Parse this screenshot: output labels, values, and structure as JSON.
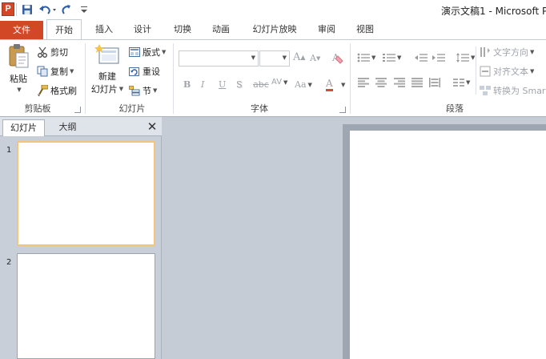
{
  "titlebar": {
    "app_icon": "P",
    "title": "演示文稿1 - Microsoft P",
    "qat_icons": [
      "save-icon",
      "undo-icon",
      "redo-icon",
      "customize-icon"
    ]
  },
  "tabs": {
    "file": "文件",
    "home": "开始",
    "insert": "插入",
    "design": "设计",
    "transitions": "切换",
    "animations": "动画",
    "slideshow": "幻灯片放映",
    "review": "审阅",
    "view": "视图"
  },
  "ribbon": {
    "clipboard": {
      "label": "剪贴板",
      "paste": "粘贴",
      "cut": "剪切",
      "copy": "复制",
      "format_painter": "格式刷"
    },
    "slides": {
      "label": "幻灯片",
      "new_slide_line1": "新建",
      "new_slide_line2": "幻灯片",
      "layout": "版式",
      "reset": "重设",
      "section": "节"
    },
    "font": {
      "label": "字体",
      "font_name": "",
      "font_size": "",
      "grow": "A",
      "shrink": "A",
      "clear": "A",
      "bold": "B",
      "italic": "I",
      "underline": "U",
      "shadow": "S",
      "strike": "abc",
      "spacing": "AV",
      "case": "Aa",
      "color": "A"
    },
    "paragraph": {
      "label": "段落",
      "text_direction": "文字方向",
      "align_text": "对齐文本",
      "convert_smartart": "转换为 Smar"
    }
  },
  "left_pane": {
    "tab_slides": "幻灯片",
    "tab_outline": "大纲",
    "close": "✕",
    "slides": [
      {
        "number": "1"
      },
      {
        "number": "2"
      }
    ]
  },
  "colors": {
    "file_tab": "#d24726",
    "ribbon_bg": "#ffffff",
    "workspace_bg": "#c6ccd5",
    "selected_thumb": "#f3c47a"
  }
}
